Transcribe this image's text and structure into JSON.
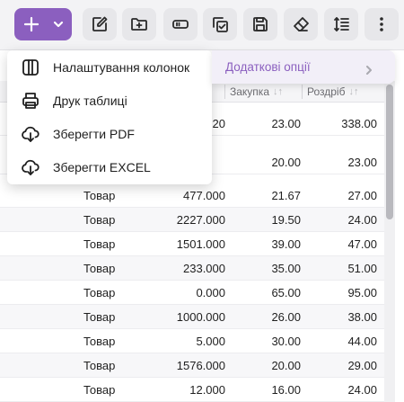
{
  "toolbar": {
    "accent": "#8b5fbf",
    "buttons": [
      "plus-icon",
      "chevron-down-icon",
      "edit-icon",
      "folder-plus-icon",
      "battery-icon",
      "copy-check-icon",
      "save-icon",
      "eraser-icon",
      "line-height-icon",
      "more-vertical-icon"
    ]
  },
  "menu": {
    "items": [
      {
        "label": "Налаштування колонок",
        "icon": "columns-icon"
      },
      {
        "label": "Друк таблиці",
        "icon": "printer-icon"
      },
      {
        "label": "Зберегти PDF",
        "icon": "cloud-download-icon"
      },
      {
        "label": "Зберегти EXCEL",
        "icon": "cloud-download-icon"
      }
    ],
    "submenu": {
      "label": "Додаткові опції"
    }
  },
  "table": {
    "headers": {
      "purchase": "Закупка",
      "retail": "Роздріб"
    },
    "hidden_rows": [
      {
        "qty_tail": "20",
        "purchase": "23.00",
        "retail": "338.00"
      },
      {
        "purchase": "20.00",
        "retail": "23.00"
      }
    ],
    "rows": [
      {
        "type": "Товар",
        "qty": "477.000",
        "purchase": "21.67",
        "retail": "27.00"
      },
      {
        "type": "Товар",
        "qty": "2227.000",
        "purchase": "19.50",
        "retail": "24.00"
      },
      {
        "type": "Товар",
        "qty": "1501.000",
        "purchase": "39.00",
        "retail": "47.00"
      },
      {
        "type": "Товар",
        "qty": "233.000",
        "purchase": "35.00",
        "retail": "51.00"
      },
      {
        "type": "Товар",
        "qty": "0.000",
        "purchase": "65.00",
        "retail": "95.00"
      },
      {
        "type": "Товар",
        "qty": "1000.000",
        "purchase": "26.00",
        "retail": "38.00"
      },
      {
        "type": "Товар",
        "qty": "5.000",
        "purchase": "30.00",
        "retail": "44.00"
      },
      {
        "type": "Товар",
        "qty": "1576.000",
        "purchase": "20.00",
        "retail": "29.00"
      },
      {
        "type": "Товар",
        "qty": "12.000",
        "purchase": "16.00",
        "retail": "24.00"
      }
    ]
  }
}
